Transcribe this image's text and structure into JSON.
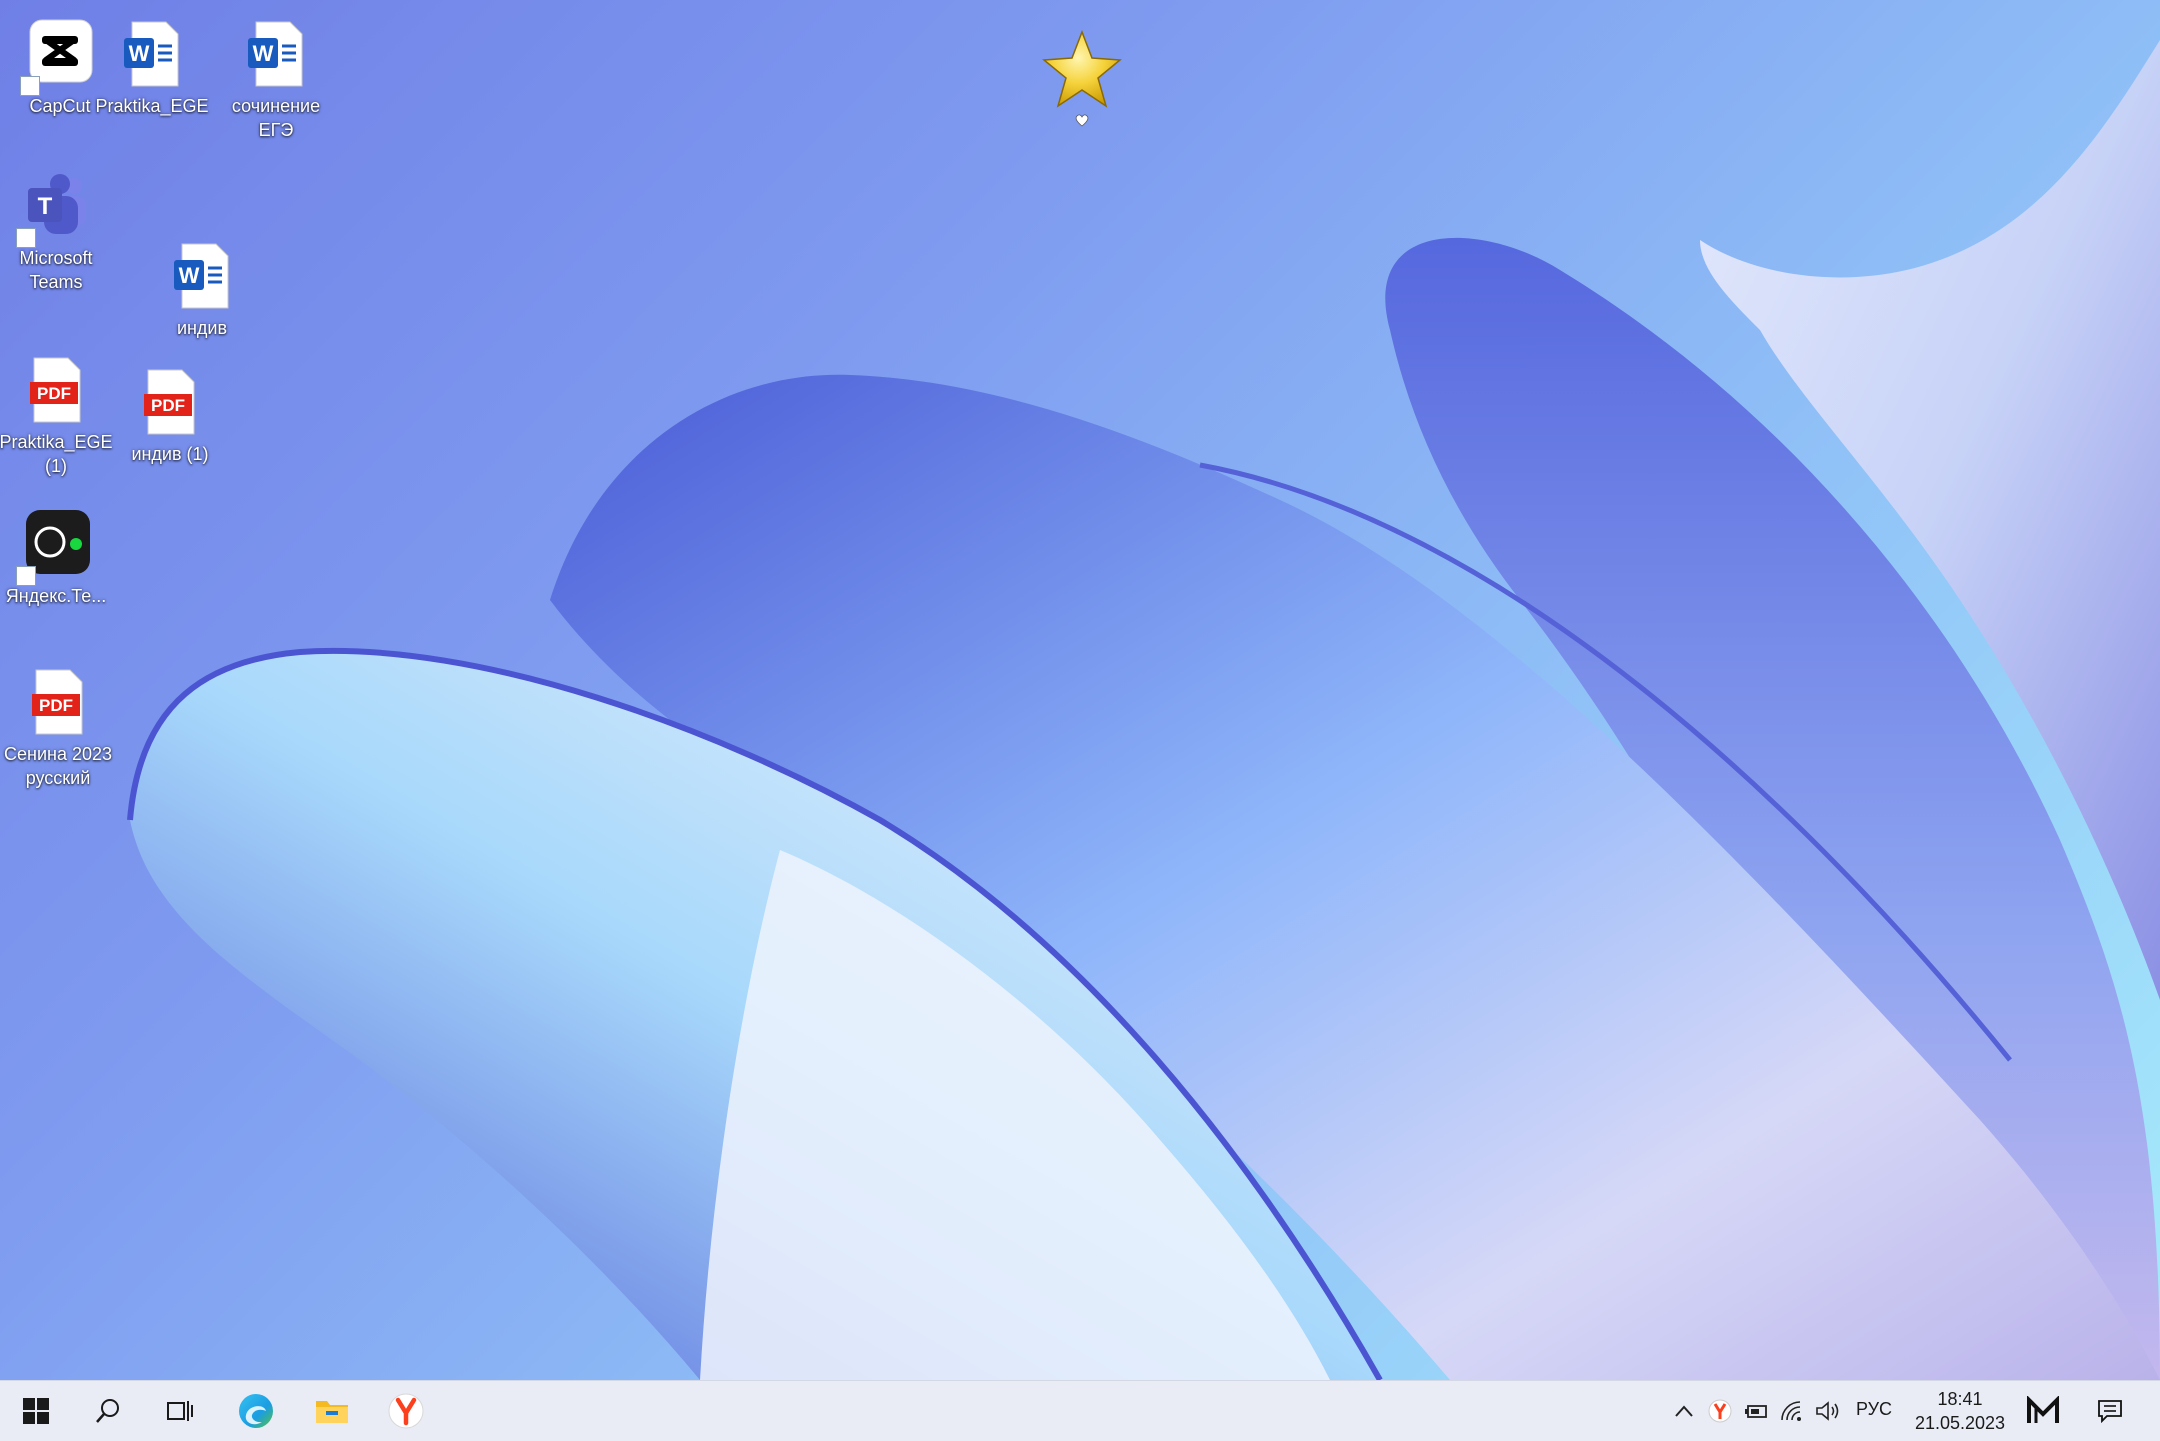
{
  "desktop": {
    "icons": [
      {
        "id": "capcut",
        "label": "CapCut",
        "type": "app-shortcut",
        "icon": "capcut-icon"
      },
      {
        "id": "praktika-docx",
        "label": "Praktika_EGE",
        "type": "word",
        "icon": "word-doc-icon"
      },
      {
        "id": "sochinenie",
        "label": "сочинение ЕГЭ",
        "type": "word",
        "icon": "word-doc-icon"
      },
      {
        "id": "teams",
        "label": "Microsoft Teams",
        "type": "app-shortcut",
        "icon": "teams-icon"
      },
      {
        "id": "indiv-docx",
        "label": "индив",
        "type": "word",
        "icon": "word-doc-icon"
      },
      {
        "id": "praktika-pdf",
        "label": "Praktika_EGE (1)",
        "type": "pdf",
        "icon": "pdf-icon"
      },
      {
        "id": "indiv-pdf",
        "label": "индив (1)",
        "type": "pdf",
        "icon": "pdf-icon"
      },
      {
        "id": "yandex-telemost",
        "label": "Яндекс.Те...",
        "type": "app-shortcut",
        "icon": "yandex-telemost-icon"
      },
      {
        "id": "senina-pdf",
        "label": "Сенина 2023 русский",
        "type": "pdf",
        "icon": "pdf-icon"
      }
    ],
    "pdf_badge": "PDF",
    "word_badge": "W",
    "teams_badge": "T",
    "star_widget": {
      "icon": "star-icon",
      "sub_icon": "heart-icon"
    }
  },
  "taskbar": {
    "pinned": [
      {
        "name": "start-button",
        "icon": "windows-logo-icon"
      },
      {
        "name": "search-button",
        "icon": "search-icon"
      },
      {
        "name": "task-view-button",
        "icon": "task-view-icon"
      },
      {
        "name": "edge-button",
        "icon": "edge-icon"
      },
      {
        "name": "explorer-button",
        "icon": "folder-icon"
      },
      {
        "name": "yandex-browser-button",
        "icon": "yandex-browser-icon"
      }
    ],
    "tray": {
      "icons": [
        "chevron-up-icon",
        "yandex-tray-icon",
        "battery-icon",
        "wifi-icon",
        "volume-icon"
      ],
      "language": "РУС",
      "time": "18:41",
      "date": "21.05.2023",
      "extra_icon": "m-logo-icon",
      "notifications_icon": "notifications-icon"
    }
  },
  "colors": {
    "taskbar_bg": "#e9ecf5",
    "pdf_red": "#e2231a",
    "word_blue": "#185abd",
    "teams_purple": "#5b5fc7",
    "accent_blue": "#0078d4"
  }
}
